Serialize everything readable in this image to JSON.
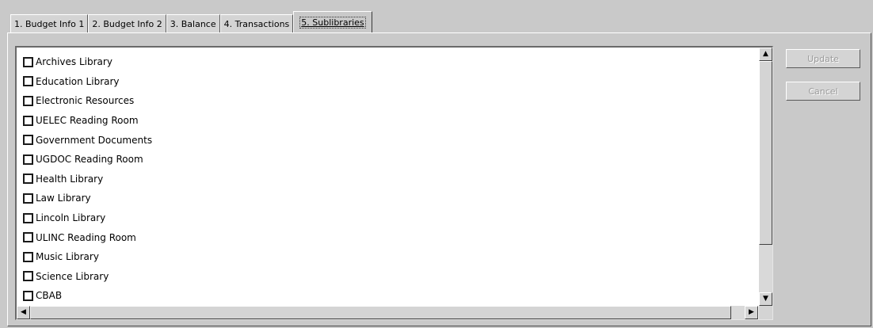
{
  "tabs": [
    {
      "label": "1. Budget Info 1",
      "active": false
    },
    {
      "label": "2. Budget Info 2",
      "active": false
    },
    {
      "label": "3. Balance",
      "active": false
    },
    {
      "label": "4. Transactions",
      "active": false
    },
    {
      "label": "5. Sublibraries",
      "active": true
    }
  ],
  "sublibraries": {
    "items": [
      {
        "label": "Archives Library",
        "checked": false
      },
      {
        "label": "Education Library",
        "checked": false
      },
      {
        "label": "Electronic Resources",
        "checked": false
      },
      {
        "label": "UELEC Reading Room",
        "checked": false
      },
      {
        "label": "Government Documents",
        "checked": false
      },
      {
        "label": "UGDOC Reading Room",
        "checked": false
      },
      {
        "label": "Health Library",
        "checked": false
      },
      {
        "label": "Law Library",
        "checked": false
      },
      {
        "label": "Lincoln Library",
        "checked": false
      },
      {
        "label": "ULINC Reading Room",
        "checked": false
      },
      {
        "label": "Music Library",
        "checked": false
      },
      {
        "label": "Science Library",
        "checked": false
      },
      {
        "label": "CBAB",
        "checked": false
      }
    ]
  },
  "buttons": {
    "update_label": "Update",
    "cancel_label": "Cancel",
    "enabled": false
  },
  "scrollbar_icons": {
    "up": "arrow-up-icon",
    "down": "arrow-down-icon",
    "left": "arrow-left-icon",
    "right": "arrow-right-icon"
  }
}
